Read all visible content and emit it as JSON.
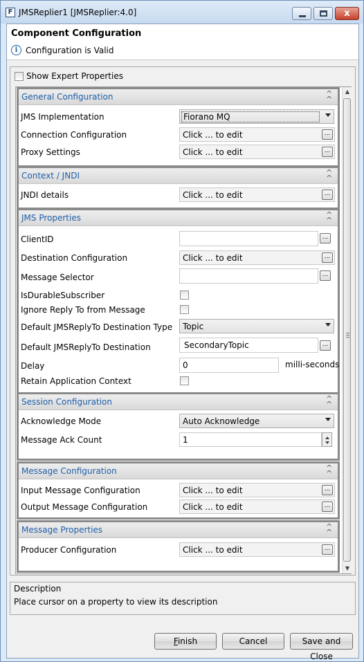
{
  "window": {
    "title": "JMSReplier1 [JMSReplier:4.0]",
    "icon_letter": "F",
    "close_glyph": "x"
  },
  "header": {
    "title": "Component Configuration",
    "status": "Configuration is Valid",
    "info_glyph": "i"
  },
  "expert": {
    "label": "Show Expert Properties"
  },
  "sections": {
    "general": {
      "title": "General Configuration",
      "jms_impl": {
        "label": "JMS Implementation",
        "value": "Fiorano MQ"
      },
      "connection": {
        "label": "Connection Configuration",
        "value": "Click ... to edit"
      },
      "proxy": {
        "label": "Proxy Settings",
        "value": "Click ... to edit"
      }
    },
    "context": {
      "title": "Context / JNDI",
      "jndi": {
        "label": "JNDI details",
        "value": "Click ... to edit"
      }
    },
    "jms": {
      "title": "JMS Properties",
      "client_id": {
        "label": "ClientID",
        "value": ""
      },
      "destination": {
        "label": "Destination Configuration",
        "value": "Click ... to edit"
      },
      "selector": {
        "label": "Message Selector",
        "value": ""
      },
      "durable": {
        "label": "IsDurableSubscriber"
      },
      "ignore_reply": {
        "label": "Ignore Reply To from Message"
      },
      "reply_type": {
        "label": "Default JMSReplyTo Destination Type",
        "value": "Topic"
      },
      "reply_dest": {
        "label": "Default JMSReplyTo Destination",
        "value": "SecondaryTopic"
      },
      "delay": {
        "label": "Delay",
        "value": "0",
        "unit": "milli-seconds"
      },
      "retain": {
        "label": "Retain Application Context"
      }
    },
    "session": {
      "title": "Session Configuration",
      "ack_mode": {
        "label": "Acknowledge Mode",
        "value": "Auto Acknowledge"
      },
      "ack_count": {
        "label": "Message Ack Count",
        "value": "1"
      }
    },
    "message": {
      "title": "Message Configuration",
      "input": {
        "label": "Input Message Configuration",
        "value": "Click ... to edit"
      },
      "output": {
        "label": "Output Message Configuration",
        "value": "Click ... to edit"
      }
    },
    "properties": {
      "title": "Message Properties",
      "producer": {
        "label": "Producer Configuration",
        "value": "Click ... to edit"
      }
    }
  },
  "ellipsis": "...",
  "chevron": "«",
  "description": {
    "title": "Description",
    "text": "Place cursor on a property to view its description"
  },
  "buttons": {
    "finish_first": "F",
    "finish_rest": "inish",
    "cancel": "Cancel",
    "save_close": "Save and Close"
  }
}
